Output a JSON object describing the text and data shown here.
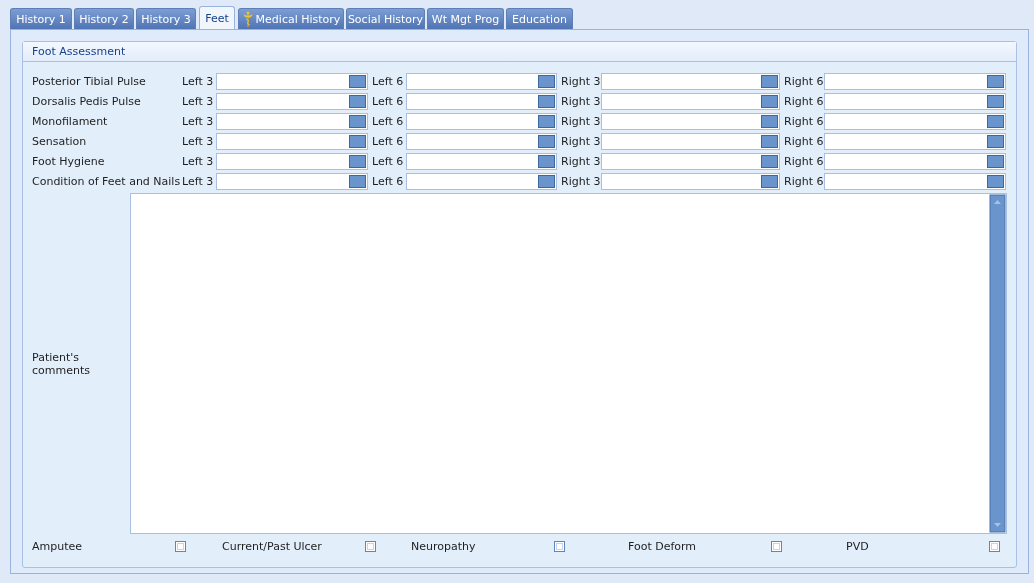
{
  "tabs": [
    {
      "label": "History 1",
      "selected": false,
      "kind": "plain"
    },
    {
      "label": "History 2",
      "selected": false,
      "kind": "plain"
    },
    {
      "label": "History 3",
      "selected": false,
      "kind": "plain"
    },
    {
      "label": "Feet",
      "selected": true,
      "kind": "plain"
    },
    {
      "label": "Medical History",
      "selected": false,
      "kind": "icon"
    },
    {
      "label": "Social History",
      "selected": false,
      "kind": "plain"
    },
    {
      "label": "Wt Mgt Prog",
      "selected": false,
      "kind": "plain"
    },
    {
      "label": "Education",
      "selected": false,
      "kind": "plain"
    }
  ],
  "group": {
    "title": "Foot Assessment",
    "rows": [
      {
        "label": "Posterior Tibial Pulse",
        "fields": [
          "Left 3",
          "Left 6",
          "Right 3",
          "Right 6"
        ]
      },
      {
        "label": "Dorsalis Pedis Pulse",
        "fields": [
          "Left 3",
          "Left 6",
          "Right 3",
          "Right 6"
        ]
      },
      {
        "label": "Monofilament",
        "fields": [
          "Left 3",
          "Left 6",
          "Right 3",
          "Right 6"
        ]
      },
      {
        "label": "Sensation",
        "fields": [
          "Left 3",
          "Left 6",
          "Right 3",
          "Right 6"
        ]
      },
      {
        "label": "Foot Hygiene",
        "fields": [
          "Left 3",
          "Left 6",
          "Right 3",
          "Right 6"
        ]
      },
      {
        "label": "Condition of Feet and Nails",
        "fields": [
          "Left 3",
          "Left 6",
          "Right 3",
          "Right 6"
        ]
      }
    ],
    "comments": {
      "label": "Patient's comments"
    },
    "checkboxes": [
      {
        "label": "Amputee",
        "checked": false
      },
      {
        "label": "Current/Past Ulcer",
        "checked": false
      },
      {
        "label": "Neuropathy",
        "checked": false
      },
      {
        "label": "Foot Deform",
        "checked": false
      },
      {
        "label": "PVD",
        "checked": false
      }
    ]
  }
}
